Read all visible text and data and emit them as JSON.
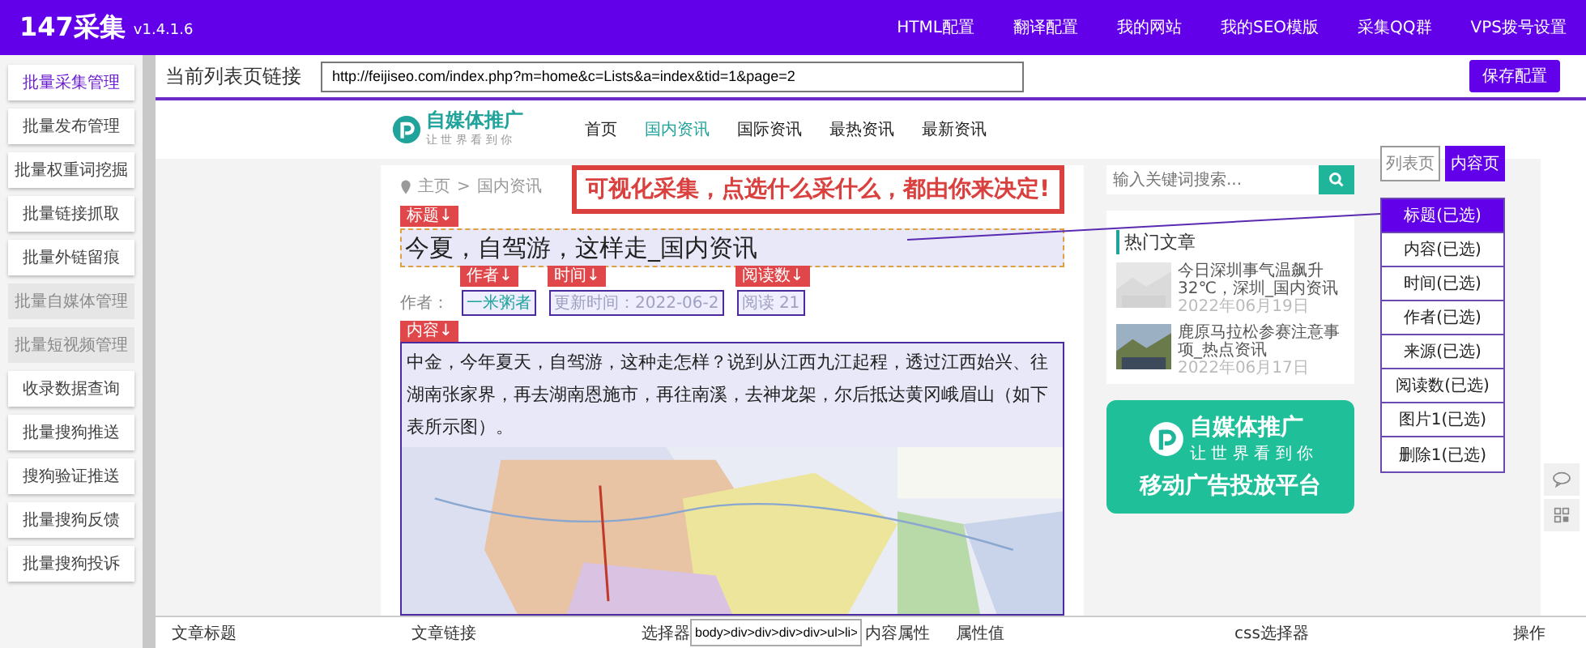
{
  "app": {
    "name": "147采集",
    "version": "v1.4.1.6"
  },
  "top_nav": [
    "HTML配置",
    "翻译配置",
    "我的网站",
    "我的SEO模版",
    "采集QQ群",
    "VPS拨号设置"
  ],
  "sidebar": [
    {
      "label": "批量采集管理",
      "selected": true,
      "disabled": false
    },
    {
      "label": "批量发布管理",
      "selected": false,
      "disabled": false
    },
    {
      "label": "批量权重词挖掘",
      "selected": false,
      "disabled": false
    },
    {
      "label": "批量链接抓取",
      "selected": false,
      "disabled": false
    },
    {
      "label": "批量外链留痕",
      "selected": false,
      "disabled": false
    },
    {
      "label": "批量自媒体管理",
      "selected": false,
      "disabled": true
    },
    {
      "label": "批量短视频管理",
      "selected": false,
      "disabled": true
    },
    {
      "label": "收录数据查询",
      "selected": false,
      "disabled": false
    },
    {
      "label": "批量搜狗推送",
      "selected": false,
      "disabled": false
    },
    {
      "label": "搜狗验证推送",
      "selected": false,
      "disabled": false
    },
    {
      "label": "批量搜狗反馈",
      "selected": false,
      "disabled": false
    },
    {
      "label": "批量搜狗投诉",
      "selected": false,
      "disabled": false
    }
  ],
  "url_bar": {
    "label": "当前列表页链接",
    "value": "http://feijiseo.com/index.php?m=home&c=Lists&a=index&tid=1&page=2",
    "button": "保存配置"
  },
  "preview": {
    "logo": {
      "name": "自媒体推广",
      "tagline": "让 世 界 看 到 你"
    },
    "nav": [
      {
        "label": "首页",
        "selected": false
      },
      {
        "label": "国内资讯",
        "selected": true
      },
      {
        "label": "国际资讯",
        "selected": false
      },
      {
        "label": "最热资讯",
        "selected": false
      },
      {
        "label": "最新资讯",
        "selected": false
      }
    ],
    "breadcrumb": [
      "主页",
      ">",
      "国内资讯"
    ],
    "banner": "可视化采集，点选什么采什么，都由你来决定!",
    "tags": {
      "title": "标题↓",
      "author": "作者↓",
      "time": "时间↓",
      "reads": "阅读数↓",
      "content": "内容↓"
    },
    "article": {
      "title": "今夏，自驾游，这样走_国内资讯",
      "author_label": "作者：",
      "author": "一米粥者",
      "updated": "更新时间：2022-06-2",
      "reads": "阅读 21",
      "content": "中金，今年夏天，自驾游，这种走怎样？说到从江西九江起程，透过江西始兴、往湖南张家界，再去湖南恩施市，再往南溪，去神龙架，尔后抵达黄冈峨眉山（如下表所示图）。"
    },
    "search": {
      "placeholder": "输入关键词搜索..."
    },
    "hot": {
      "heading": "热门文章",
      "items": [
        {
          "title": "今日深圳事气温飙升32℃，深圳_国内资讯",
          "date": "2022年06月19日"
        },
        {
          "title": "鹿原马拉松参赛注意事项_热点资讯",
          "date": "2022年06月17日"
        }
      ]
    },
    "ad": {
      "name": "自媒体推广",
      "tagline": "让 世 界 看 到 你",
      "slogan": "移动广告投放平台"
    }
  },
  "page_type_tabs": [
    {
      "label": "列表页",
      "selected": false
    },
    {
      "label": "内容页",
      "selected": true
    }
  ],
  "fields": [
    {
      "label": "标题(已选)",
      "selected": true
    },
    {
      "label": "内容(已选)",
      "selected": false
    },
    {
      "label": "时间(已选)",
      "selected": false
    },
    {
      "label": "作者(已选)",
      "selected": false
    },
    {
      "label": "来源(已选)",
      "selected": false
    },
    {
      "label": "阅读数(已选)",
      "selected": false
    },
    {
      "label": "图片1(已选)",
      "selected": false
    },
    {
      "label": "删除1(已选)",
      "selected": false
    }
  ],
  "table": {
    "columns": [
      "文章标题",
      "文章链接",
      "选择器",
      "内容属性",
      "属性值",
      "css选择器",
      "操作"
    ],
    "selector_value": "body>div>div>div>div>ul>li>"
  }
}
